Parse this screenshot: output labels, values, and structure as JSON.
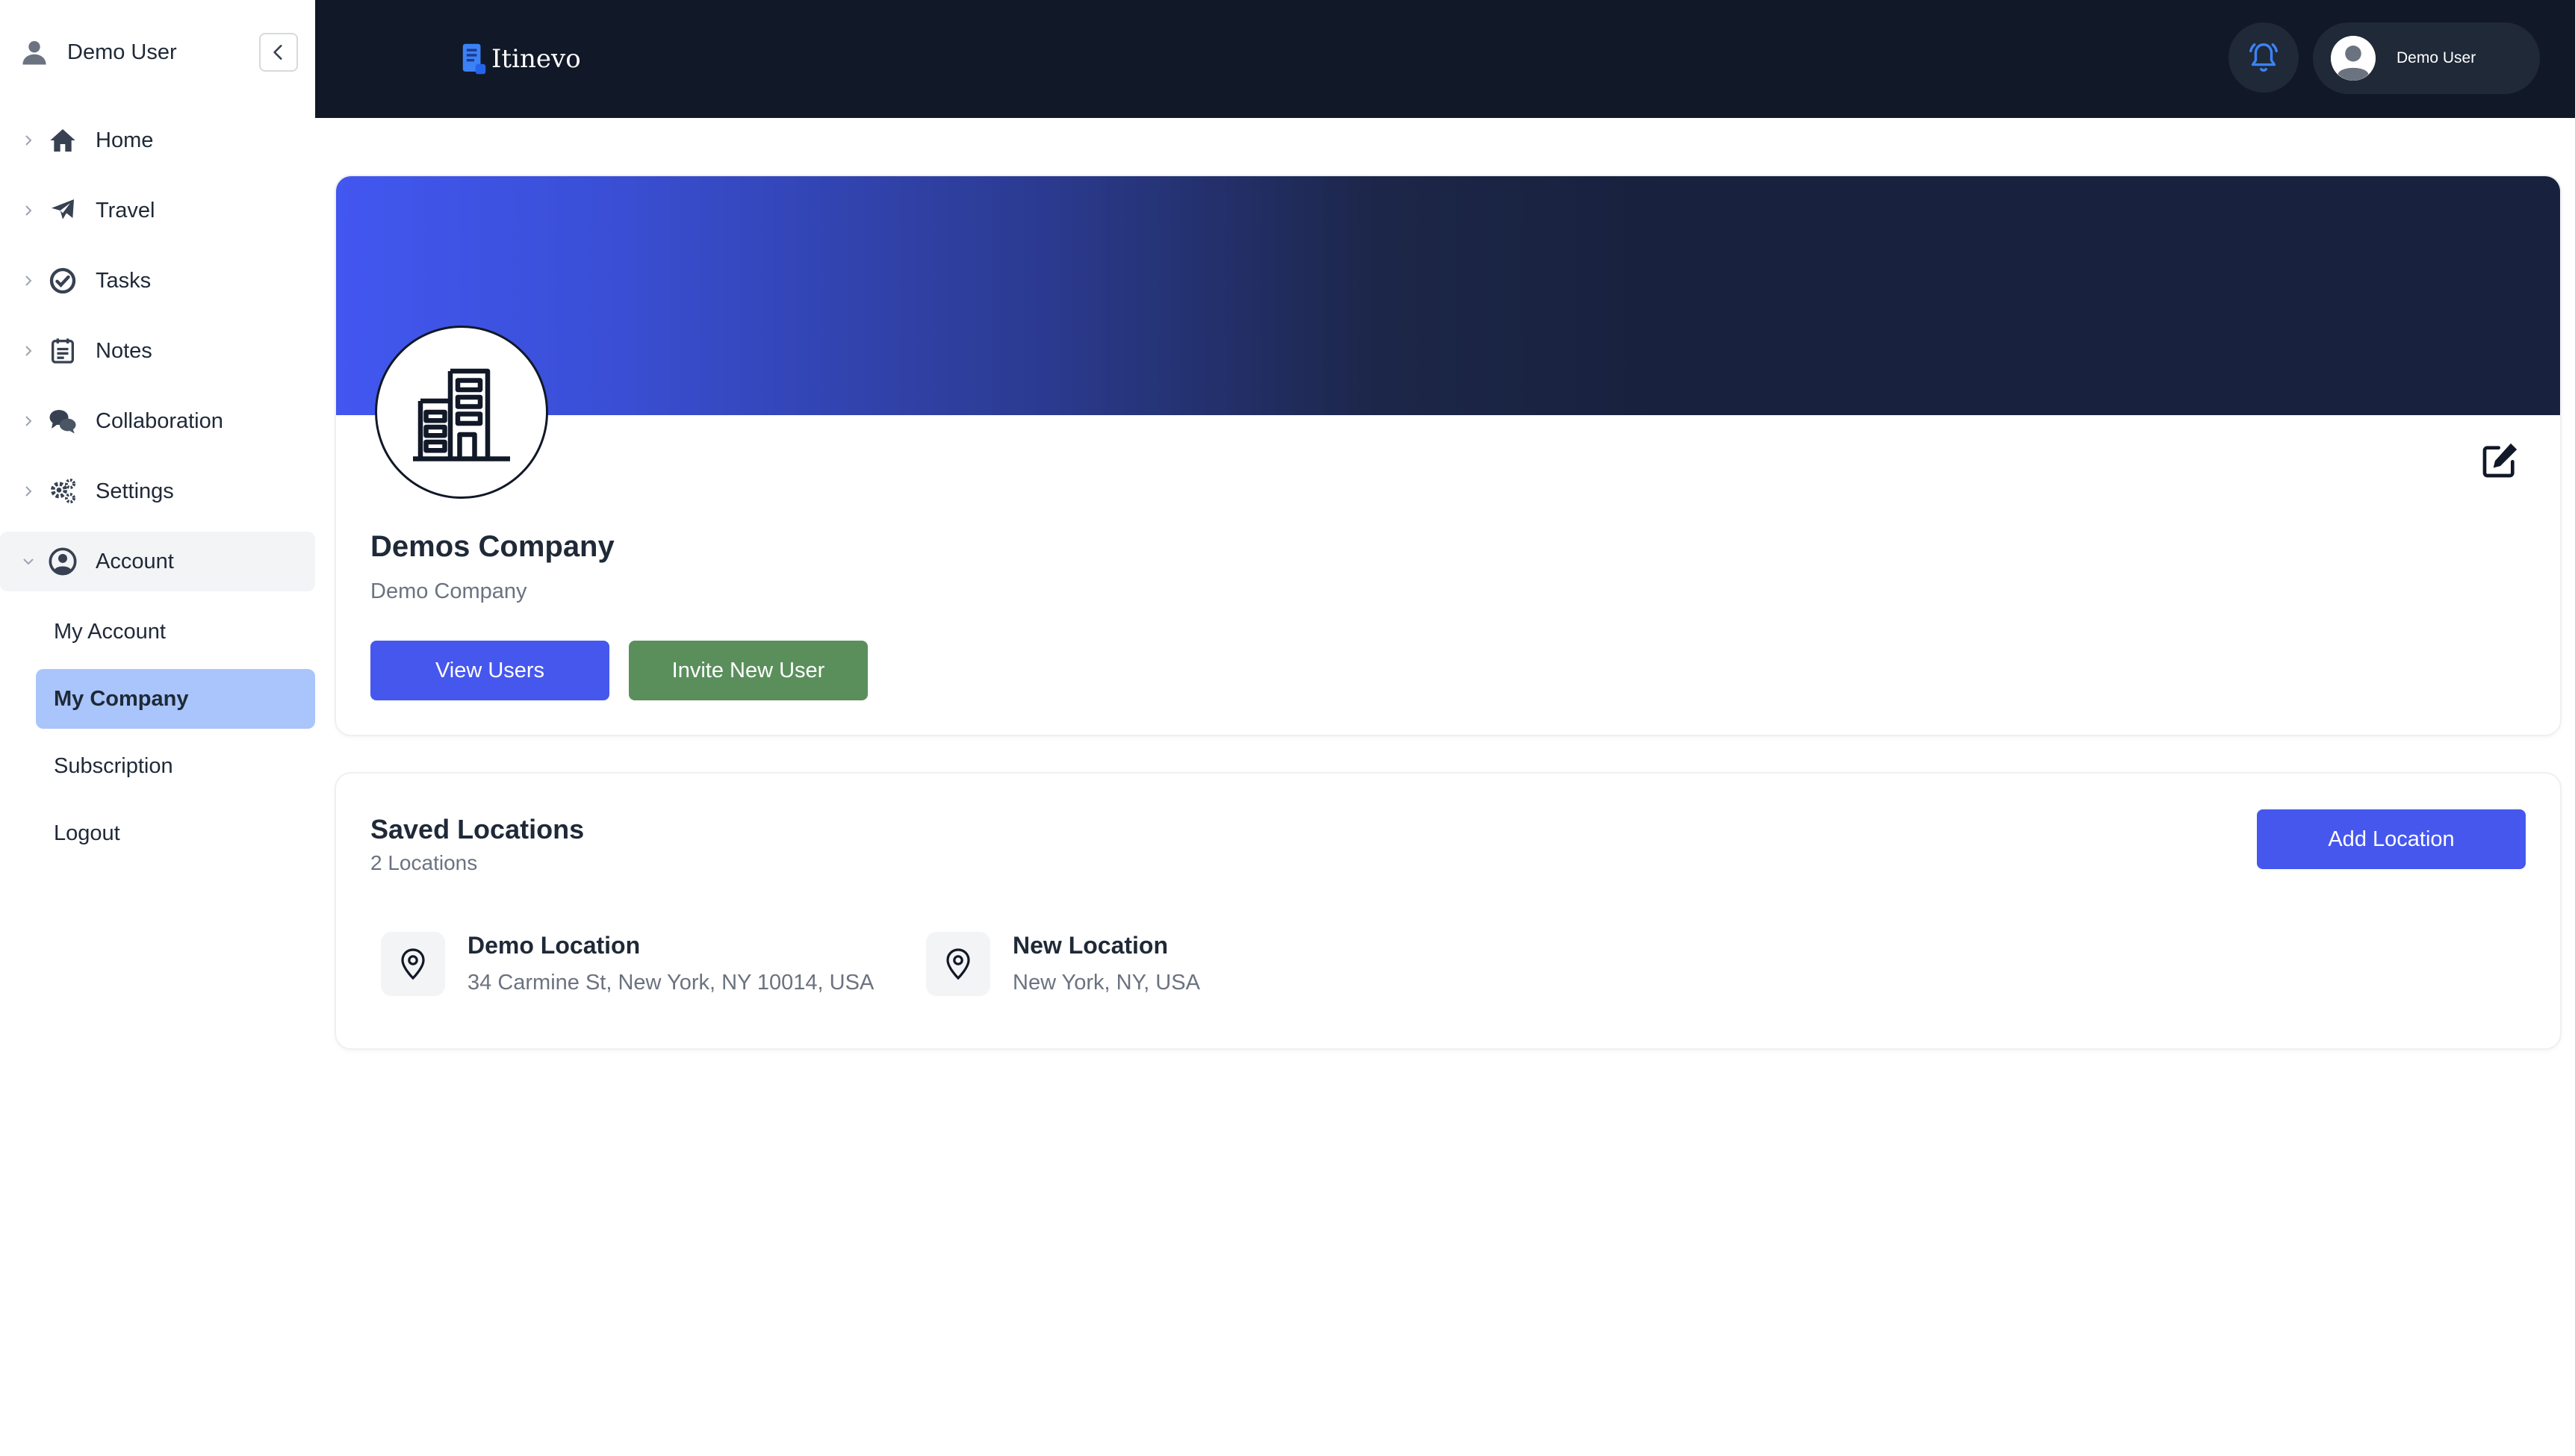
{
  "sidebar": {
    "user_name": "Demo User",
    "nav": [
      {
        "label": "Home",
        "icon": "home-icon"
      },
      {
        "label": "Travel",
        "icon": "plane-icon"
      },
      {
        "label": "Tasks",
        "icon": "check-circle-icon"
      },
      {
        "label": "Notes",
        "icon": "notes-icon"
      },
      {
        "label": "Collaboration",
        "icon": "chat-icon"
      },
      {
        "label": "Settings",
        "icon": "gears-icon"
      },
      {
        "label": "Account",
        "icon": "account-icon"
      }
    ],
    "account_sub": [
      "My Account",
      "My Company",
      "Subscription",
      "Logout"
    ],
    "active_sub": "My Company"
  },
  "topbar": {
    "logo_text": "Itinevo",
    "user_name": "Demo User"
  },
  "company": {
    "name": "Demos Company",
    "subtitle": "Demo Company",
    "view_users_label": "View Users",
    "invite_label": "Invite New User"
  },
  "locations": {
    "title": "Saved Locations",
    "count_text": "2 Locations",
    "add_label": "Add Location",
    "items": [
      {
        "name": "Demo Location",
        "address": "34 Carmine St, New York, NY 10014, USA"
      },
      {
        "name": "New Location",
        "address": "New York, NY, USA"
      }
    ]
  },
  "colors": {
    "primary": "#4657ee",
    "success": "#5a8f5c",
    "topbar": "#111827",
    "active_sub_bg": "#a9c5fb"
  }
}
